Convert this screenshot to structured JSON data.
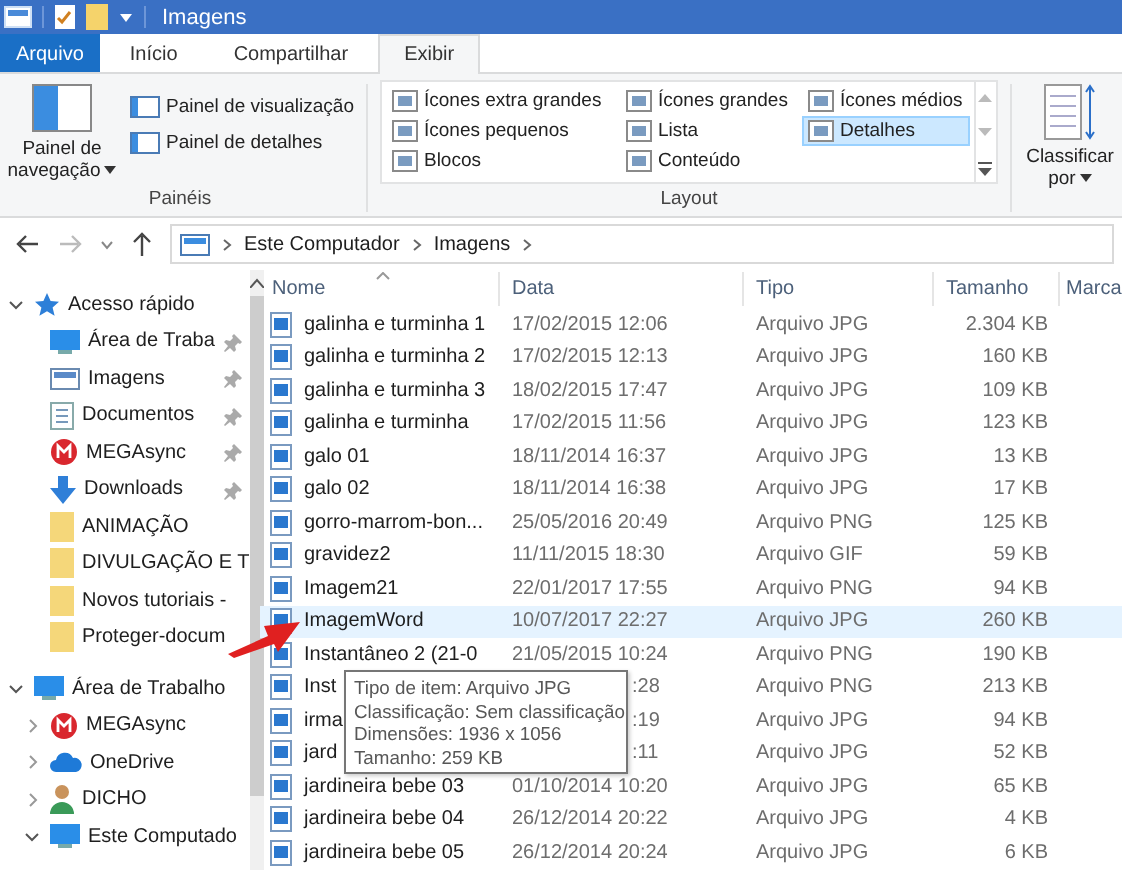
{
  "window": {
    "title": "Imagens"
  },
  "ribbon_tabs": [
    {
      "label": "Arquivo",
      "kind": "file",
      "selected": false
    },
    {
      "label": "Início",
      "kind": "tab",
      "selected": false
    },
    {
      "label": "Compartilhar",
      "kind": "tab",
      "selected": false
    },
    {
      "label": "Exibir",
      "kind": "tab",
      "selected": true
    }
  ],
  "panes_group": {
    "title": "Painéis",
    "nav_pane": "Painel de navegação",
    "buttons": [
      "Painel de visualização",
      "Painel de detalhes"
    ]
  },
  "layout_group": {
    "title": "Layout",
    "options": [
      {
        "label": "Ícones extra grandes",
        "selected": false
      },
      {
        "label": "Ícones grandes",
        "selected": false
      },
      {
        "label": "Ícones médios",
        "selected": false
      },
      {
        "label": "Ícones pequenos",
        "selected": false
      },
      {
        "label": "Lista",
        "selected": false
      },
      {
        "label": "Detalhes",
        "selected": true
      },
      {
        "label": "Blocos",
        "selected": false
      },
      {
        "label": "Conteúdo",
        "selected": false
      }
    ]
  },
  "sort_button": "Classificar por",
  "address": {
    "path": [
      "Este Computador",
      "Imagens"
    ]
  },
  "nav_pane": {
    "items": [
      {
        "label": "Acesso rápido",
        "kind": "star",
        "expanded": true,
        "children": [
          {
            "label": "Área de Traba",
            "kind": "desktop",
            "pinned": true
          },
          {
            "label": "Imagens",
            "kind": "pictures",
            "pinned": true
          },
          {
            "label": "Documentos",
            "kind": "documents",
            "pinned": true
          },
          {
            "label": "MEGAsync",
            "kind": "mega",
            "pinned": true
          },
          {
            "label": "Downloads",
            "kind": "download",
            "pinned": true
          },
          {
            "label": "ANIMAÇÃO",
            "kind": "folder",
            "pinned": false
          },
          {
            "label": "DIVULGAÇÃO E T",
            "kind": "folder",
            "pinned": false
          },
          {
            "label": "Novos tutoriais -",
            "kind": "folder",
            "pinned": false
          },
          {
            "label": "Proteger-docum",
            "kind": "folder",
            "pinned": false
          }
        ]
      },
      {
        "label": "Área de Trabalho",
        "kind": "desktop",
        "expanded": true,
        "children": [
          {
            "label": "MEGAsync",
            "kind": "mega",
            "expanded": false
          },
          {
            "label": "OneDrive",
            "kind": "cloud",
            "expanded": false
          },
          {
            "label": "DICHO",
            "kind": "person",
            "expanded": false
          },
          {
            "label": "Este Computado",
            "kind": "computer",
            "expanded": true
          }
        ]
      }
    ]
  },
  "columns": [
    "Nome",
    "Data",
    "Tipo",
    "Tamanho",
    "Marca"
  ],
  "rows": [
    {
      "name": "galinha e turminha 1",
      "date": "17/02/2015 12:06",
      "type": "Arquivo JPG",
      "size": "2.304 KB",
      "hovered": false,
      "covered": false
    },
    {
      "name": "galinha e turminha 2",
      "date": "17/02/2015 12:13",
      "type": "Arquivo JPG",
      "size": "160 KB",
      "hovered": false,
      "covered": false
    },
    {
      "name": "galinha e turminha 3",
      "date": "18/02/2015 17:47",
      "type": "Arquivo JPG",
      "size": "109 KB",
      "hovered": false,
      "covered": false
    },
    {
      "name": "galinha e turminha",
      "date": "17/02/2015 11:56",
      "type": "Arquivo JPG",
      "size": "123 KB",
      "hovered": false,
      "covered": false
    },
    {
      "name": "galo 01",
      "date": "18/11/2014 16:37",
      "type": "Arquivo JPG",
      "size": "13 KB",
      "hovered": false,
      "covered": false
    },
    {
      "name": "galo 02",
      "date": "18/11/2014 16:38",
      "type": "Arquivo JPG",
      "size": "17 KB",
      "hovered": false,
      "covered": false
    },
    {
      "name": "gorro-marrom-bon...",
      "date": "25/05/2016 20:49",
      "type": "Arquivo PNG",
      "size": "125 KB",
      "hovered": false,
      "covered": false
    },
    {
      "name": "gravidez2",
      "date": "11/11/2015 18:30",
      "type": "Arquivo GIF",
      "size": "59 KB",
      "hovered": false,
      "covered": false
    },
    {
      "name": "Imagem21",
      "date": "22/01/2017 17:55",
      "type": "Arquivo PNG",
      "size": "94 KB",
      "hovered": false,
      "covered": false
    },
    {
      "name": "ImagemWord",
      "date": "10/07/2017 22:27",
      "type": "Arquivo JPG",
      "size": "260 KB",
      "hovered": true,
      "covered": false
    },
    {
      "name": "Instantâneo 2 (21-0",
      "date": "21/05/2015 10:24",
      "type": "Arquivo PNG",
      "size": "190 KB",
      "hovered": false,
      "covered": false
    },
    {
      "name": "Inst",
      "date": ":28",
      "type": "Arquivo PNG",
      "size": "213 KB",
      "hovered": false,
      "covered": true
    },
    {
      "name": "irma",
      "date": ":19",
      "type": "Arquivo JPG",
      "size": "94 KB",
      "hovered": false,
      "covered": true
    },
    {
      "name": "jard",
      "date": ":11",
      "type": "Arquivo JPG",
      "size": "52 KB",
      "hovered": false,
      "covered": true
    },
    {
      "name": "jardineira bebe 03",
      "date": "01/10/2014 10:20",
      "type": "Arquivo JPG",
      "size": "65 KB",
      "hovered": false,
      "covered": false
    },
    {
      "name": "jardineira bebe 04",
      "date": "26/12/2014 20:22",
      "type": "Arquivo JPG",
      "size": "4 KB",
      "hovered": false,
      "covered": false
    },
    {
      "name": "jardineira bebe 05",
      "date": "26/12/2014 20:24",
      "type": "Arquivo JPG",
      "size": "6 KB",
      "hovered": false,
      "covered": false
    }
  ],
  "tooltip": {
    "lines": [
      "Tipo de item: Arquivo JPG",
      "Classificação: Sem classificação",
      "Dimensões: 1936 x 1056",
      "Tamanho: 259 KB"
    ]
  }
}
